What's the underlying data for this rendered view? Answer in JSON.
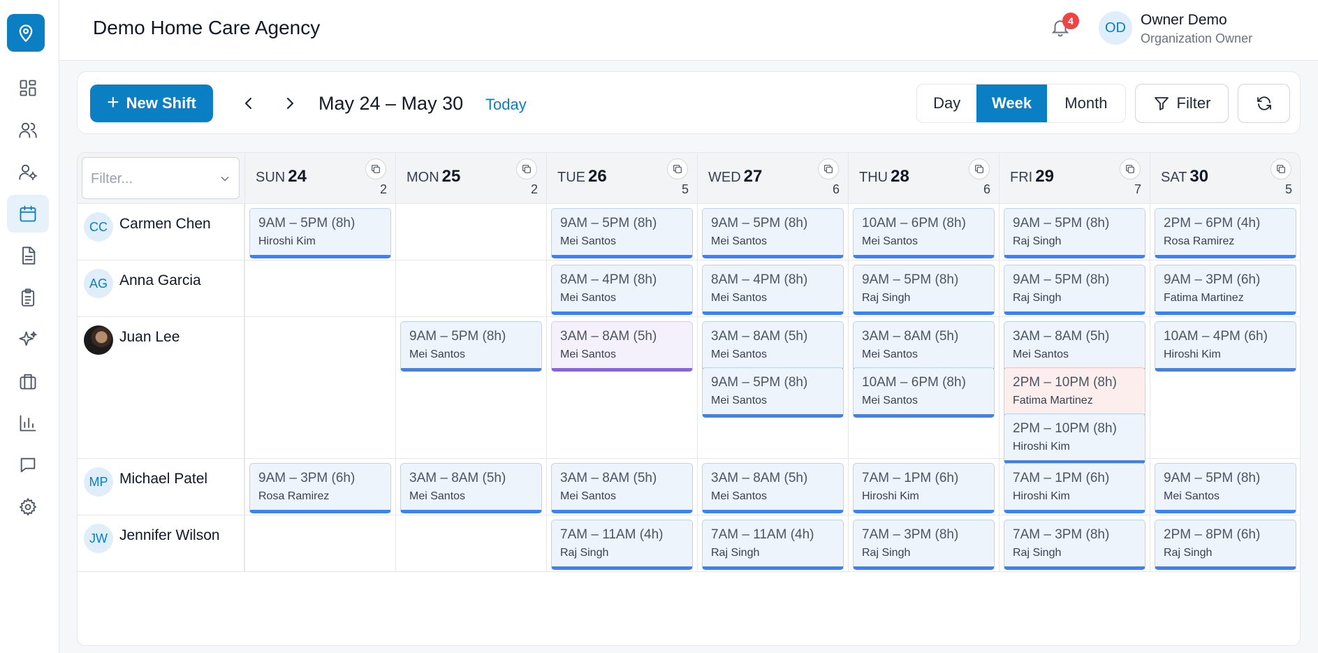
{
  "header": {
    "org_title": "Demo Home Care Agency",
    "notification_count": "4",
    "user_initials": "OD",
    "user_name": "Owner Demo",
    "user_role": "Organization Owner"
  },
  "sidebar": {
    "items": [
      {
        "icon": "dashboard-icon",
        "active": false
      },
      {
        "icon": "users-icon",
        "active": false
      },
      {
        "icon": "user-settings-icon",
        "active": false
      },
      {
        "icon": "calendar-icon",
        "active": true
      },
      {
        "icon": "document-icon",
        "active": false
      },
      {
        "icon": "clipboard-icon",
        "active": false
      },
      {
        "icon": "sparkles-icon",
        "active": false
      },
      {
        "icon": "briefcase-icon",
        "active": false
      },
      {
        "icon": "bar-chart-icon",
        "active": false
      },
      {
        "icon": "message-icon",
        "active": false
      },
      {
        "icon": "gear-icon",
        "active": false
      }
    ]
  },
  "toolbar": {
    "new_shift_label": "New Shift",
    "date_range": "May 24 – May 30",
    "today_label": "Today",
    "views": [
      "Day",
      "Week",
      "Month"
    ],
    "active_view": "Week",
    "filter_label": "Filter"
  },
  "grid": {
    "filter_placeholder": "Filter...",
    "days": [
      {
        "name": "SUN",
        "num": "24",
        "count": "2"
      },
      {
        "name": "MON",
        "num": "25",
        "count": "2"
      },
      {
        "name": "TUE",
        "num": "26",
        "count": "5"
      },
      {
        "name": "WED",
        "num": "27",
        "count": "6"
      },
      {
        "name": "THU",
        "num": "28",
        "count": "6"
      },
      {
        "name": "FRI",
        "num": "29",
        "count": "7"
      },
      {
        "name": "SAT",
        "num": "30",
        "count": "5"
      }
    ],
    "rows": [
      {
        "name": "Carmen Chen",
        "initials": "CC",
        "photo": false,
        "cells": [
          [
            {
              "time": "9AM – 5PM (8h)",
              "person": "Hiroshi Kim"
            }
          ],
          [],
          [
            {
              "time": "9AM – 5PM (8h)",
              "person": "Mei Santos"
            }
          ],
          [
            {
              "time": "9AM – 5PM (8h)",
              "person": "Mei Santos"
            }
          ],
          [
            {
              "time": "10AM – 6PM (8h)",
              "person": "Mei Santos"
            }
          ],
          [
            {
              "time": "9AM – 5PM (8h)",
              "person": "Raj Singh"
            }
          ],
          [
            {
              "time": "2PM – 6PM (4h)",
              "person": "Rosa Ramirez"
            }
          ]
        ]
      },
      {
        "name": "Anna Garcia",
        "initials": "AG",
        "photo": false,
        "cells": [
          [],
          [],
          [
            {
              "time": "8AM – 4PM (8h)",
              "person": "Mei Santos"
            }
          ],
          [
            {
              "time": "8AM – 4PM (8h)",
              "person": "Mei Santos"
            }
          ],
          [
            {
              "time": "9AM – 5PM (8h)",
              "person": "Raj Singh"
            }
          ],
          [
            {
              "time": "9AM – 5PM (8h)",
              "person": "Raj Singh"
            }
          ],
          [
            {
              "time": "9AM – 3PM (6h)",
              "person": "Fatima Martinez"
            }
          ]
        ]
      },
      {
        "name": "Juan Lee",
        "initials": "",
        "photo": true,
        "cells": [
          [],
          [
            {
              "time": "9AM – 5PM (8h)",
              "person": "Mei Santos"
            }
          ],
          [
            {
              "time": "3AM – 8AM (5h)",
              "person": "Mei Santos",
              "style": "purple"
            }
          ],
          [
            {
              "time": "3AM – 8AM (5h)",
              "person": "Mei Santos"
            },
            {
              "time": "9AM – 5PM (8h)",
              "person": "Mei Santos"
            }
          ],
          [
            {
              "time": "3AM – 8AM (5h)",
              "person": "Mei Santos"
            },
            {
              "time": "10AM – 6PM (8h)",
              "person": "Mei Santos"
            }
          ],
          [
            {
              "time": "3AM – 8AM (5h)",
              "person": "Mei Santos"
            },
            {
              "time": "2PM – 10PM (8h)",
              "person": "Fatima Martinez",
              "style": "red"
            },
            {
              "time": "2PM – 10PM (8h)",
              "person": "Hiroshi Kim"
            }
          ],
          [
            {
              "time": "10AM – 4PM (6h)",
              "person": "Hiroshi Kim"
            }
          ]
        ]
      },
      {
        "name": "Michael Patel",
        "initials": "MP",
        "photo": false,
        "cells": [
          [
            {
              "time": "9AM – 3PM (6h)",
              "person": "Rosa Ramirez"
            }
          ],
          [
            {
              "time": "3AM – 8AM (5h)",
              "person": "Mei Santos"
            }
          ],
          [
            {
              "time": "3AM – 8AM (5h)",
              "person": "Mei Santos"
            }
          ],
          [
            {
              "time": "3AM – 8AM (5h)",
              "person": "Mei Santos"
            }
          ],
          [
            {
              "time": "7AM – 1PM (6h)",
              "person": "Hiroshi Kim"
            }
          ],
          [
            {
              "time": "7AM – 1PM (6h)",
              "person": "Hiroshi Kim"
            }
          ],
          [
            {
              "time": "9AM – 5PM (8h)",
              "person": "Mei Santos"
            }
          ]
        ]
      },
      {
        "name": "Jennifer Wilson",
        "initials": "JW",
        "photo": false,
        "cells": [
          [],
          [],
          [
            {
              "time": "7AM – 11AM (4h)",
              "person": "Raj Singh"
            }
          ],
          [
            {
              "time": "7AM – 11AM (4h)",
              "person": "Raj Singh"
            }
          ],
          [
            {
              "time": "7AM – 3PM (8h)",
              "person": "Raj Singh"
            }
          ],
          [
            {
              "time": "7AM – 3PM (8h)",
              "person": "Raj Singh"
            }
          ],
          [
            {
              "time": "2PM – 8PM (6h)",
              "person": "Raj Singh"
            }
          ]
        ]
      }
    ]
  },
  "colors": {
    "primary": "#0a7fc4",
    "shift_default_bar": "#3b82f6",
    "shift_purple_bar": "#8b5cf6",
    "shift_red_bar": "#e53e3e",
    "badge": "#ef4444"
  }
}
